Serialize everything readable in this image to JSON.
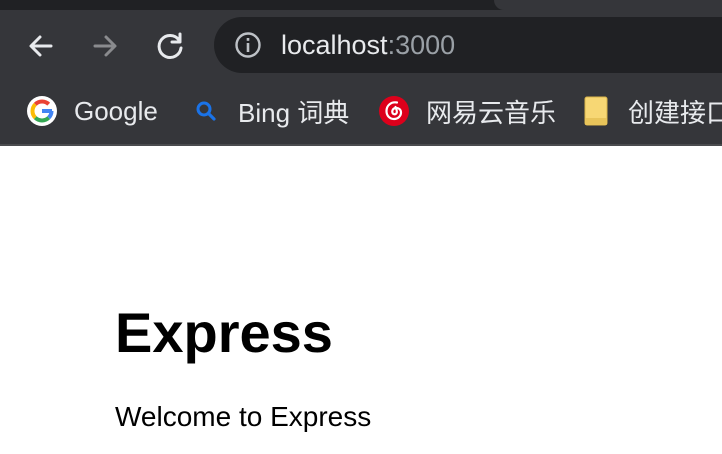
{
  "browser": {
    "address_bar": {
      "host": "localhost",
      "port": ":3000",
      "info_icon": "info-icon"
    },
    "nav": {
      "back_icon": "arrow-left-icon",
      "forward_icon": "arrow-right-icon",
      "reload_icon": "reload-icon"
    },
    "bookmarks": [
      {
        "label": "Google",
        "icon": "google-icon"
      },
      {
        "label": "Bing 词典",
        "icon": "search-icon"
      },
      {
        "label": "网易云音乐",
        "icon": "netease-music-icon"
      },
      {
        "label": "创建接口",
        "icon": "folder-icon"
      }
    ],
    "colors": {
      "toolbar": "#35363a",
      "omnibox": "#202124",
      "text": "#e8eaed",
      "muted_text": "#9aa0a6",
      "netease_red": "#dd001b",
      "bing_blue": "#1a73e8",
      "folder_yellow": "#f7d774"
    }
  },
  "page": {
    "heading": "Express",
    "body": "Welcome to Express"
  }
}
